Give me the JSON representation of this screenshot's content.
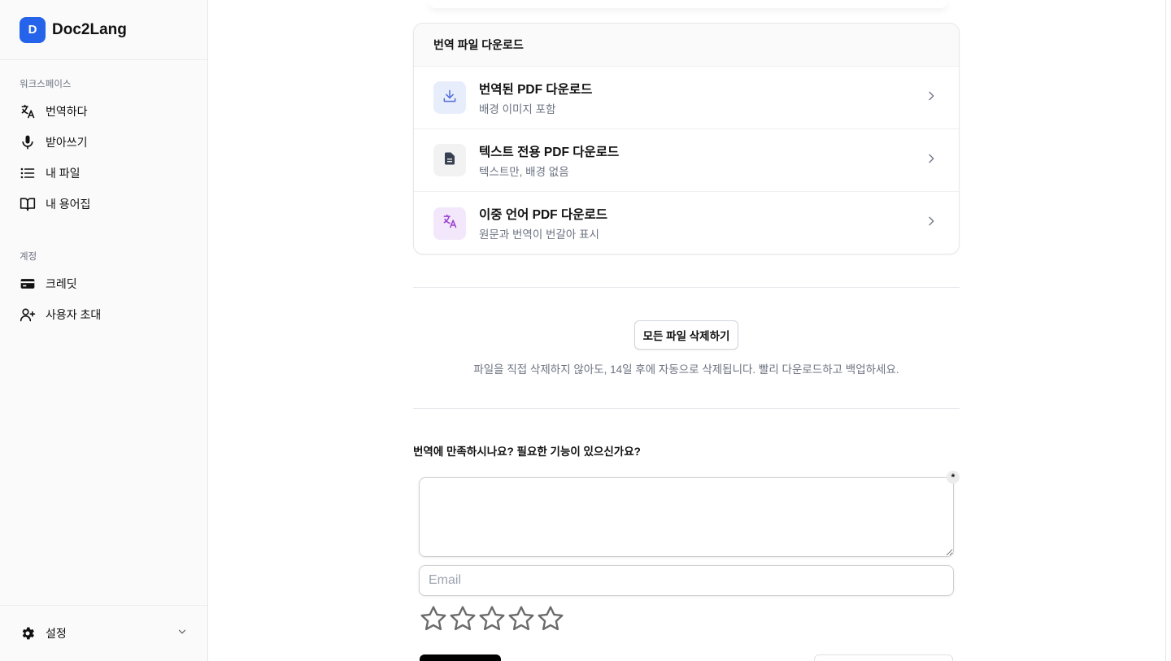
{
  "app": {
    "logo_letter": "D",
    "name": "Doc2Lang"
  },
  "sidebar": {
    "workspace_title": "워크스페이스",
    "workspace_items": [
      {
        "label": "번역하다",
        "icon": "translate-icon"
      },
      {
        "label": "받아쓰기",
        "icon": "microphone-icon"
      },
      {
        "label": "내 파일",
        "icon": "list-icon"
      },
      {
        "label": "내 용어집",
        "icon": "book-icon"
      }
    ],
    "account_title": "계정",
    "account_items": [
      {
        "label": "크레딧",
        "icon": "credit-card-icon"
      },
      {
        "label": "사용자 초대",
        "icon": "user-plus-icon"
      }
    ],
    "footer": {
      "label": "설정",
      "icon": "gear-icon"
    }
  },
  "downloads": {
    "title": "번역 파일 다운로드",
    "items": [
      {
        "title": "번역된 PDF 다운로드",
        "subtitle": "배경 이미지 포함",
        "icon": "download-icon",
        "color": "#4f6bd8",
        "bg": "#e8edfc"
      },
      {
        "title": "텍스트 전용 PDF 다운로드",
        "subtitle": "텍스트만, 배경 없음",
        "icon": "document-icon",
        "color": "#374151",
        "bg": "#f2f2f3"
      },
      {
        "title": "이중 언어 PDF 다운로드",
        "subtitle": "원문과 번역이 번갈아 표시",
        "icon": "translate-icon",
        "color": "#9b3fd0",
        "bg": "#f3e8fb"
      }
    ]
  },
  "delete": {
    "button_label": "모든 파일 삭제하기",
    "note": "파일을 직접 삭제하지 않아도, 14일 후에 자동으로 삭제됩니다. 빨리 다운로드하고 백업하세요."
  },
  "feedback": {
    "question": "번역에 만족하시나요? 필요한 기능이 있으신가요?",
    "required_mark": "*",
    "email_placeholder": "Email",
    "rating": 0,
    "rating_max": 5
  },
  "colors": {
    "accent": "#2563eb"
  }
}
